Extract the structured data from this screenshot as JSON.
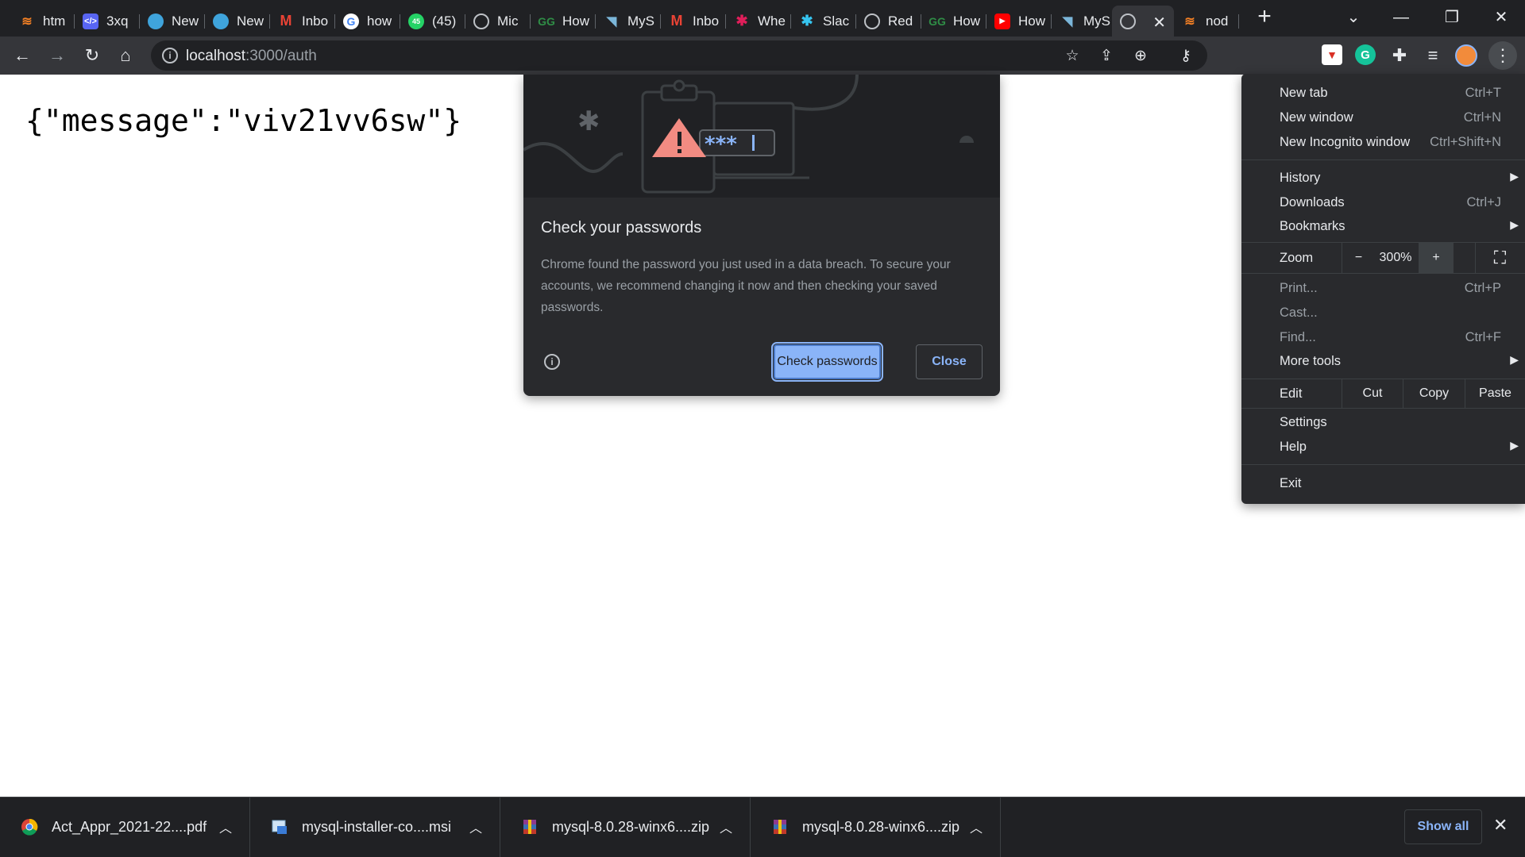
{
  "tabs": [
    {
      "title": "htm",
      "icon": "stackoverflow-icon",
      "color": "#f48024"
    },
    {
      "title": "3xq",
      "icon": "code-icon",
      "color": "#5865f2"
    },
    {
      "title": "New",
      "icon": "edge-icon",
      "color": "#3fa4dc"
    },
    {
      "title": "New",
      "icon": "edge-icon",
      "color": "#3fa4dc"
    },
    {
      "title": "Inbo",
      "icon": "gmail-icon",
      "color": "#ea4335"
    },
    {
      "title": "how",
      "icon": "google-icon",
      "color": "#4285f4"
    },
    {
      "title": "(45)",
      "icon": "whatsapp-icon",
      "color": "#25d366"
    },
    {
      "title": "Mic",
      "icon": "globe-icon",
      "color": "#9aa0a6"
    },
    {
      "title": "How",
      "icon": "geeksforgeeks-icon",
      "color": "#2f8d46"
    },
    {
      "title": "MyS",
      "icon": "mysql-icon",
      "color": "#00758f"
    },
    {
      "title": "Inbo",
      "icon": "gmail-icon",
      "color": "#ea4335"
    },
    {
      "title": "Whe",
      "icon": "slack-icon",
      "color": "#e01e5a"
    },
    {
      "title": "Slac",
      "icon": "slack-icon",
      "color": "#36c5f0"
    },
    {
      "title": "Red",
      "icon": "globe-icon",
      "color": "#9aa0a6"
    },
    {
      "title": "How",
      "icon": "geeksforgeeks-icon",
      "color": "#2f8d46"
    },
    {
      "title": "How",
      "icon": "youtube-icon",
      "color": "#ff0000"
    },
    {
      "title": "MyS",
      "icon": "mysql-icon",
      "color": "#00758f"
    },
    {
      "title": "",
      "icon": "globe-icon",
      "color": "#9aa0a6",
      "active": true
    },
    {
      "title": "nod",
      "icon": "stackoverflow-icon",
      "color": "#f48024"
    }
  ],
  "address": {
    "host": "localhost",
    "path": ":3000/auth"
  },
  "page": {
    "json_text": "{\"message\":\"viv21vv6sw\"}"
  },
  "password_dialog": {
    "title": "Check your passwords",
    "body": "Chrome found the password you just used in a data breach. To secure your accounts, we recommend changing it now and then checking your saved passwords.",
    "primary_label": "Check passwords",
    "close_label": "Close"
  },
  "menu": {
    "new_tab": {
      "label": "New tab",
      "shortcut": "Ctrl+T"
    },
    "new_window": {
      "label": "New window",
      "shortcut": "Ctrl+N"
    },
    "new_incognito": {
      "label": "New Incognito window",
      "shortcut": "Ctrl+Shift+N"
    },
    "history": {
      "label": "History"
    },
    "downloads": {
      "label": "Downloads",
      "shortcut": "Ctrl+J"
    },
    "bookmarks": {
      "label": "Bookmarks"
    },
    "zoom": {
      "label": "Zoom",
      "minus": "−",
      "value": "300%",
      "plus": "+"
    },
    "print": {
      "label": "Print...",
      "shortcut": "Ctrl+P"
    },
    "cast": {
      "label": "Cast..."
    },
    "find": {
      "label": "Find...",
      "shortcut": "Ctrl+F"
    },
    "more_tools": {
      "label": "More tools"
    },
    "edit": {
      "label": "Edit",
      "cut": "Cut",
      "copy": "Copy",
      "paste": "Paste"
    },
    "settings": {
      "label": "Settings"
    },
    "help": {
      "label": "Help"
    },
    "exit": {
      "label": "Exit"
    }
  },
  "downloads": [
    {
      "name": "Act_Appr_2021-22....pdf",
      "icon": "chrome-pdf-icon"
    },
    {
      "name": "mysql-installer-co....msi",
      "icon": "installer-icon"
    },
    {
      "name": "mysql-8.0.28-winx6....zip",
      "icon": "winrar-icon"
    },
    {
      "name": "mysql-8.0.28-winx6....zip",
      "icon": "winrar-icon"
    }
  ],
  "shelf": {
    "show_all": "Show all"
  },
  "colors": {
    "accent": "#8ab4f8",
    "warning": "#f28b82",
    "chrome_dark": "#202124"
  }
}
